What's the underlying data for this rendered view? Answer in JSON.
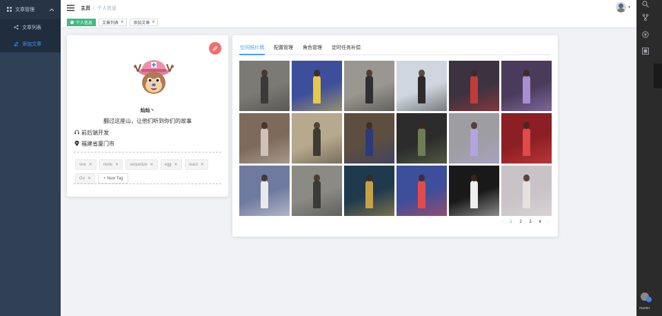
{
  "sidebar": {
    "group_label": "文章管理",
    "items": [
      {
        "label": "文章列表",
        "icon": "share-icon"
      },
      {
        "label": "添加文章",
        "icon": "edit-icon"
      }
    ]
  },
  "navbar": {
    "home": "主页",
    "separator": "/",
    "current": "个人信息"
  },
  "tagsview": [
    {
      "label": "个人信息",
      "active": true
    },
    {
      "label": "文章列表",
      "active": false
    },
    {
      "label": "添加文章",
      "active": false
    }
  ],
  "profile": {
    "nickname": "灿灿丶",
    "bio": "翻过这座山，让他们听到你们的故事",
    "job": "前后端开发",
    "location": "福建省厦门市",
    "tags": [
      "vue",
      "node",
      "sequelize",
      "egg",
      "react",
      "Go"
    ],
    "new_tag_label": "+ New Tag",
    "edit_icon": "edit-icon"
  },
  "photos": {
    "tabs": [
      "空间照片墙",
      "配置管理",
      "角色管理",
      "定时任务补偿"
    ],
    "active_tab": 0,
    "pagination": {
      "prev": "‹",
      "next": "›",
      "pages": [
        "1",
        "2",
        "3",
        "4"
      ],
      "current": "1"
    },
    "tiles": [
      {
        "bg": "#7b7a75",
        "accent": "#3a3a38"
      },
      {
        "bg": "#3d4e9a",
        "accent": "#e6c94a"
      },
      {
        "bg": "#9a9790",
        "accent": "#2f2f2f"
      },
      {
        "bg": "#cfd6df",
        "accent": "#2d2b2c"
      },
      {
        "bg": "#3b3340",
        "accent": "#c23b3b"
      },
      {
        "bg": "#4a3b5c",
        "accent": "#a78fd0"
      },
      {
        "bg": "#7d6a5b",
        "accent": "#cfc2b5"
      },
      {
        "bg": "#b7a98d",
        "accent": "#3f3a33"
      },
      {
        "bg": "#5d4e3f",
        "accent": "#2c3a7a"
      },
      {
        "bg": "#2c2c2c",
        "accent": "#6f7d55"
      },
      {
        "bg": "#9e9ea2",
        "accent": "#b3a4df"
      },
      {
        "bg": "#8c1f24",
        "accent": "#e04a4a"
      },
      {
        "bg": "#6f7aa0",
        "accent": "#e9e9e9"
      },
      {
        "bg": "#8b8a84",
        "accent": "#3a3a38"
      },
      {
        "bg": "#1f3a4d",
        "accent": "#c7a14a"
      },
      {
        "bg": "#3d4e9a",
        "accent": "#e34b4b"
      },
      {
        "bg": "#191919",
        "accent": "#eeeeee"
      },
      {
        "bg": "#c9c3c8",
        "accent": "#e6e1de"
      }
    ]
  },
  "rightbar": {
    "icons": [
      "search-icon",
      "branch-icon",
      "chip-icon",
      "layout-icon"
    ],
    "branch_label": "master"
  }
}
